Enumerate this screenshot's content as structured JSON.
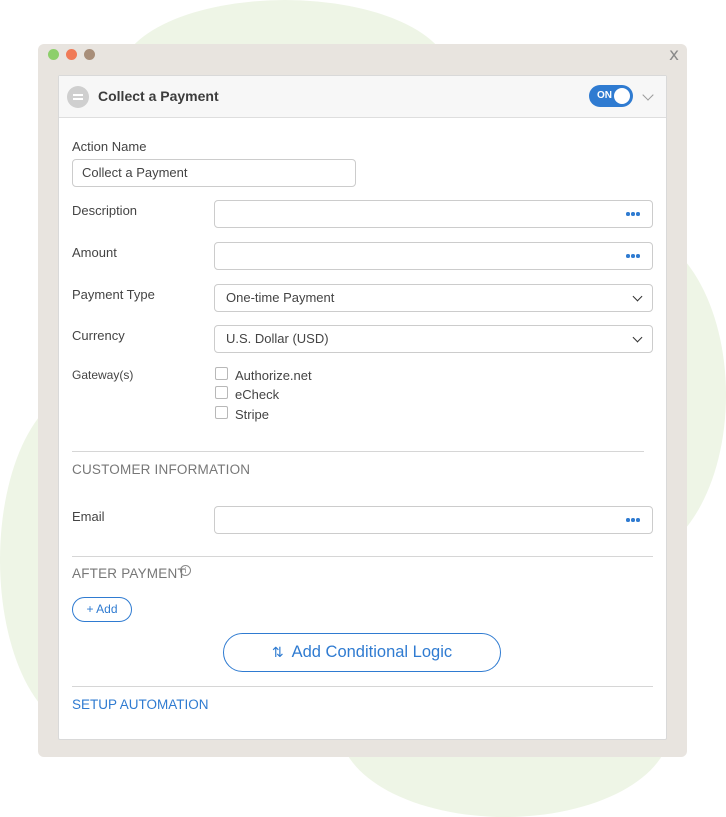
{
  "window": {
    "close_label": "x"
  },
  "panel": {
    "title": "Collect a Payment",
    "toggle_label": "ON"
  },
  "form": {
    "action_name": {
      "label": "Action Name",
      "value": "Collect a Payment"
    },
    "description": {
      "label": "Description",
      "value": ""
    },
    "amount": {
      "label": "Amount",
      "value": ""
    },
    "payment_type": {
      "label": "Payment Type",
      "selected": "One-time Payment"
    },
    "currency": {
      "label": "Currency",
      "selected": "U.S. Dollar (USD)"
    },
    "gateways": {
      "label": "Gateway(s)",
      "options": [
        "Authorize.net",
        "eCheck",
        "Stripe"
      ]
    }
  },
  "customer_info": {
    "title": "CUSTOMER INFORMATION",
    "email": {
      "label": "Email",
      "value": ""
    }
  },
  "after_payment": {
    "title": "AFTER PAYMENT",
    "add_label": "+ Add",
    "conditional_logic_label": "Add Conditional Logic"
  },
  "setup_automation_label": "SETUP AUTOMATION",
  "colors": {
    "accent": "#2f7bd1",
    "background_blob": "#eef5e6",
    "window_frame": "#e8e4df"
  },
  "icons": {
    "header": "payment-card-icon",
    "more": "more-dots-icon",
    "logic": "conditional-logic-icon",
    "info": "info-icon"
  }
}
